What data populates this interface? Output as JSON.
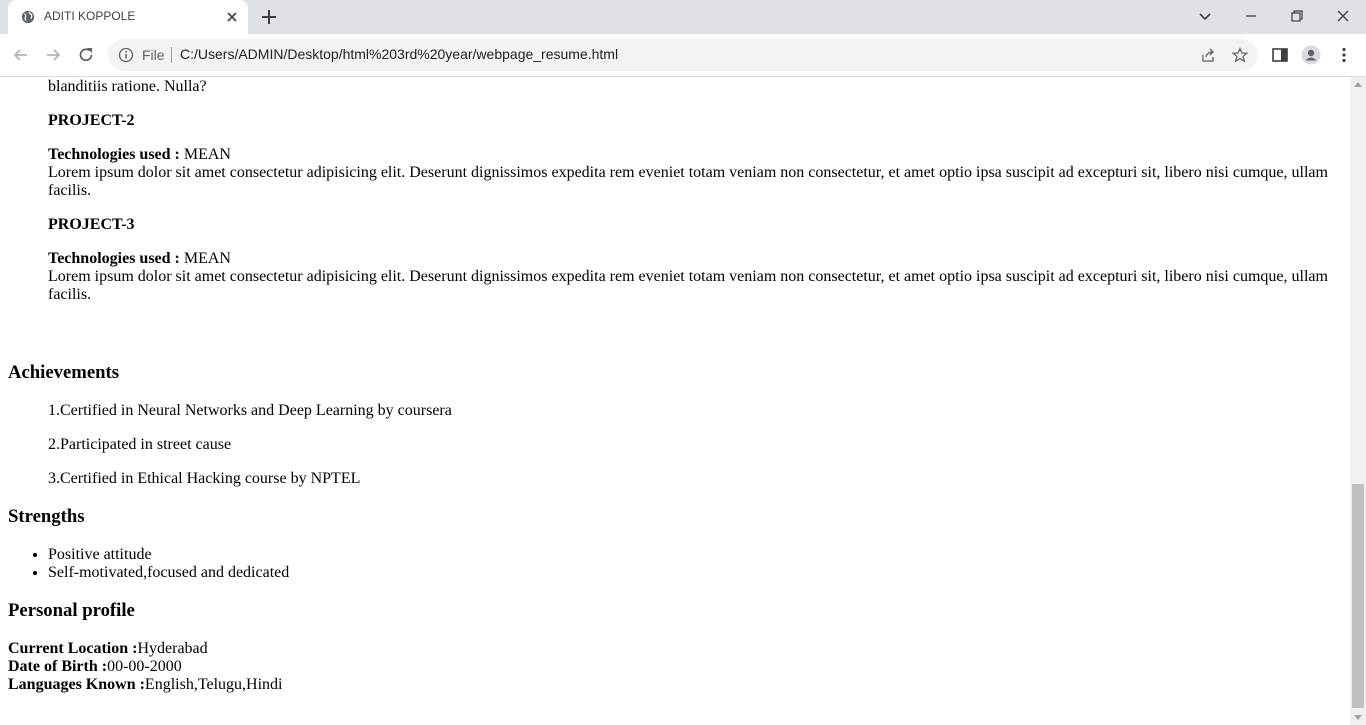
{
  "browser": {
    "tab_title": "ADITI KOPPOLE",
    "file_label": "File",
    "url": "C:/Users/ADMIN/Desktop/html%203rd%20year/webpage_resume.html"
  },
  "projects": {
    "intro_text": "Lorem ipsum dolor, sit amet consectetur adipisicing elit. Reprehenderit, quis voluptates sed quia illo soluta est minus minima vel voluptatibus rem maxime obcaecati asperiatur dicta vitae reiciendis blanditiis ratione. Nulla?",
    "tech_label": "Technologies used :",
    "items": [
      {
        "title": "PROJECT-2",
        "tech": " MEAN",
        "description": "Lorem ipsum dolor sit amet consectetur adipisicing elit. Deserunt dignissimos expedita rem eveniet totam veniam non consectetur, et amet optio ipsa suscipit ad excepturi sit, libero nisi cumque, ullam facilis."
      },
      {
        "title": "PROJECT-3",
        "tech": " MEAN",
        "description": "Lorem ipsum dolor sit amet consectetur adipisicing elit. Deserunt dignissimos expedita rem eveniet totam veniam non consectetur, et amet optio ipsa suscipit ad excepturi sit, libero nisi cumque, ullam facilis."
      }
    ]
  },
  "achievements": {
    "heading": "Achievements",
    "items": [
      "1.Certified in Neural Networks and Deep Learning by coursera",
      "2.Participated in street cause",
      "3.Certified in Ethical Hacking course by NPTEL"
    ]
  },
  "strengths": {
    "heading": "Strengths",
    "items": [
      "Positive attitude",
      "Self-motivated,focused and dedicated"
    ]
  },
  "profile": {
    "heading": "Personal profile",
    "location_label": "Current Location :",
    "location": "Hyderabad",
    "dob_label": "Date of Birth :",
    "dob": "00-00-2000",
    "languages_label": "Languages Known :",
    "languages": "English,Telugu,Hindi"
  }
}
